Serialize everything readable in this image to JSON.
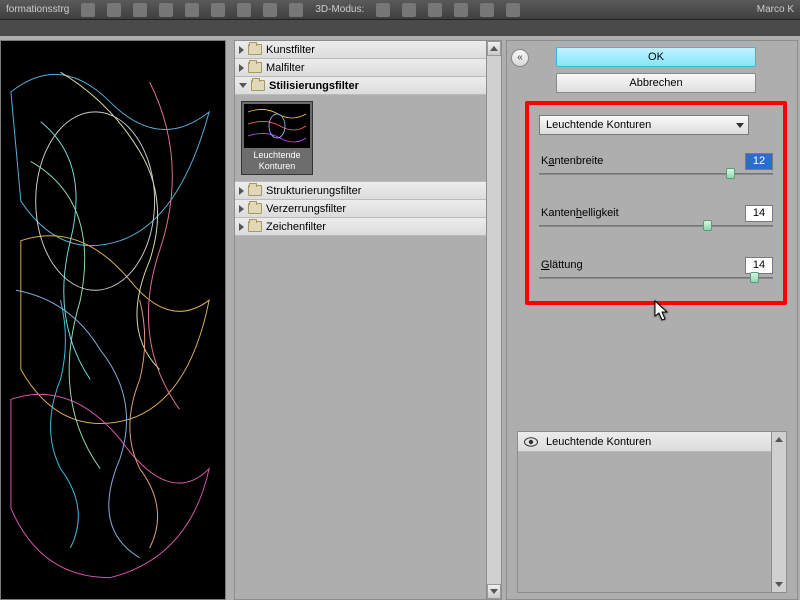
{
  "topbar": {
    "left_label": "formationsstrg",
    "mode3d": "3D-Modus:",
    "user": "Marco K"
  },
  "tree": {
    "items": [
      {
        "label": "Kunstfilter",
        "open": false
      },
      {
        "label": "Malfilter",
        "open": false
      },
      {
        "label": "Stilisierungsfilter",
        "open": true,
        "selected": true
      },
      {
        "label": "Strukturierungsfilter",
        "open": false
      },
      {
        "label": "Verzerrungsfilter",
        "open": false
      },
      {
        "label": "Zeichenfilter",
        "open": false
      }
    ],
    "thumb_caption": "Leuchtende\nKonturen"
  },
  "controls": {
    "ok_label": "OK",
    "cancel_label": "Abbrechen",
    "dropdown_value": "Leuchtende Konturen",
    "sliders": [
      {
        "label_pre": "K",
        "label_ul": "a",
        "label_post": "ntenbreite",
        "value": "12",
        "pos": 80,
        "selected": true
      },
      {
        "label_pre": "Kanten",
        "label_ul": "h",
        "label_post": "elligkeit",
        "value": "14",
        "pos": 70,
        "selected": false
      },
      {
        "label_pre": "",
        "label_ul": "G",
        "label_post": "lättung",
        "value": "14",
        "pos": 90,
        "selected": false
      }
    ]
  },
  "layers": {
    "row0": "Leuchtende Konturen"
  },
  "chart_data": null
}
